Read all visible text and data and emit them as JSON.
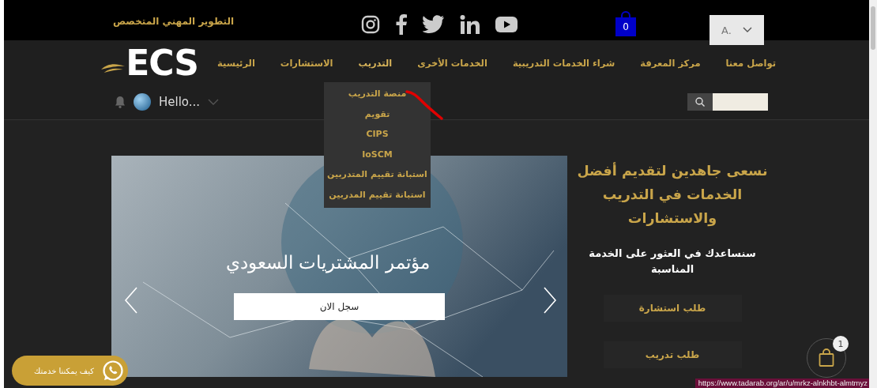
{
  "top_bar": {
    "tagline": "التطوير المهني المتخصص",
    "cart_count": "0",
    "language": "A."
  },
  "nav": {
    "logo": "ECS",
    "items": [
      {
        "label": "تواصل معنا",
        "expanded": false
      },
      {
        "label": "مركز المعرفة",
        "expanded": false
      },
      {
        "label": "شراء الخدمات التدريبية",
        "expanded": false
      },
      {
        "label": "الخدمات الأخرى",
        "expanded": false
      },
      {
        "label": "التدريب",
        "expanded": true
      },
      {
        "label": "الاستشارات",
        "expanded": false
      },
      {
        "label": "الرئيسية",
        "expanded": false
      }
    ],
    "greeting": "Hello..."
  },
  "dropdown": {
    "items": [
      "منصة التدريب",
      "تقويم",
      "CIPS",
      "IoSCM",
      "استبانة تقييم المتدربين",
      "استبانة تقييم المدربين"
    ]
  },
  "hero": {
    "title": "مؤتمر المشتريات السعودي",
    "button": "سجل الان"
  },
  "side": {
    "heading": "نسعى جاهدين لتقديم أفضل الخدمات في التدريب والاستشارات",
    "subtitle": "سنساعدك في العثور على الخدمة المناسبة",
    "buttons": [
      "طلب استشارة",
      "طلب تدريب"
    ]
  },
  "whatsapp": {
    "label": "كيف يمكننا خدمتك"
  },
  "cart_badge": "1",
  "status_url": "https://www.tadarab.org/ar/u/mrkz-alnkhbt-almtmyz"
}
